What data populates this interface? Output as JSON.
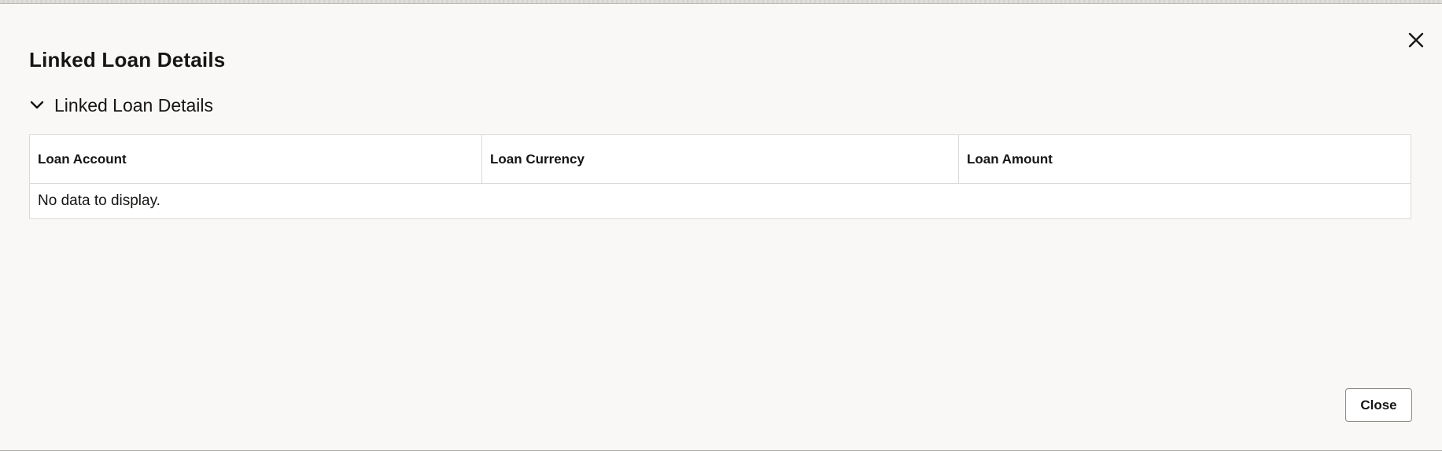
{
  "dialog": {
    "title": "Linked Loan Details",
    "close_icon": "close-icon",
    "section": {
      "title": "Linked Loan Details",
      "toggle_icon": "chevron-down-icon",
      "expanded": true
    },
    "table": {
      "columns": [
        "Loan Account",
        "Loan Currency",
        "Loan Amount"
      ],
      "rows": [],
      "empty_text": "No data to display."
    },
    "footer": {
      "close_label": "Close"
    }
  },
  "colors": {
    "dialog_bg": "#f9f8f6",
    "text": "#161513",
    "border": "#dcdad6"
  }
}
